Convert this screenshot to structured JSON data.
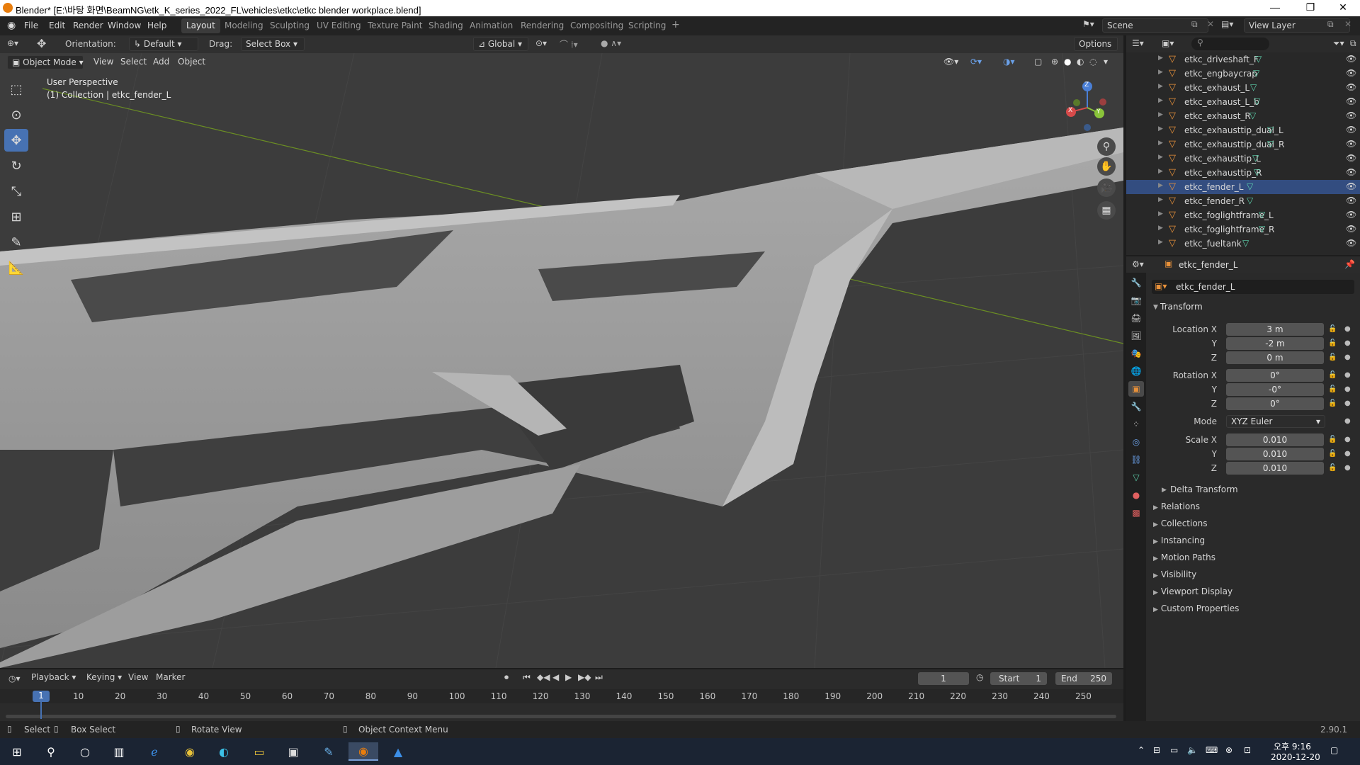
{
  "window": {
    "title": "Blender* [E:\\바탕 화면\\BeamNG\\etk_K_series_2022_FL\\vehicles\\etkc\\etkc blender workplace.blend]",
    "controls": [
      "—",
      "❐",
      "✕"
    ]
  },
  "menus": [
    "File",
    "Edit",
    "Render",
    "Window",
    "Help"
  ],
  "workspaces": [
    "Layout",
    "Modeling",
    "Sculpting",
    "UV Editing",
    "Texture Paint",
    "Shading",
    "Animation",
    "Rendering",
    "Compositing",
    "Scripting"
  ],
  "active_workspace": "Layout",
  "scene": {
    "label": "Scene",
    "view_layer": "View Layer"
  },
  "tool_header": {
    "orientation_label": "Orientation:",
    "orientation_value": "Default",
    "drag_label": "Drag:",
    "drag_value": "Select Box",
    "transform_orientation": "Global",
    "options": "Options"
  },
  "view_header": {
    "mode": "Object Mode",
    "items": [
      "View",
      "Select",
      "Add",
      "Object"
    ]
  },
  "viewport": {
    "line1": "User Perspective",
    "line2": "(1) Collection | etkc_fender_L",
    "gizmo": {
      "x": "X",
      "y": "Y",
      "z": "Z"
    }
  },
  "outliner": {
    "items": [
      "etkc_driveshaft_F",
      "etkc_engbaycrap",
      "etkc_exhaust_L",
      "etkc_exhaust_L_b",
      "etkc_exhaust_R",
      "etkc_exhausttip_dual_L",
      "etkc_exhausttip_dual_R",
      "etkc_exhausttip_L",
      "etkc_exhausttip_R",
      "etkc_fender_L",
      "etkc_fender_R",
      "etkc_foglightframe_L",
      "etkc_foglightframe_R",
      "etkc_fueltank"
    ],
    "selected": "etkc_fender_L"
  },
  "properties": {
    "header_object": "etkc_fender_L",
    "object_name": "etkc_fender_L",
    "transform_title": "Transform",
    "location": {
      "label": "Location X",
      "x": "3 m",
      "y": "-2 m",
      "z": "0 m"
    },
    "rotation": {
      "label": "Rotation X",
      "x": "0°",
      "y": "-0°",
      "z": "0°"
    },
    "mode": {
      "label": "Mode",
      "value": "XYZ Euler"
    },
    "scale": {
      "label": "Scale X",
      "x": "0.010",
      "y": "0.010",
      "z": "0.010"
    },
    "axis_y": "Y",
    "axis_z": "Z",
    "delta": "Delta Transform",
    "panels": [
      "Relations",
      "Collections",
      "Instancing",
      "Motion Paths",
      "Visibility",
      "Viewport Display",
      "Custom Properties"
    ]
  },
  "timeline": {
    "menus": [
      "Playback",
      "Keying",
      "View",
      "Marker"
    ],
    "current_frame": "1",
    "start_label": "Start",
    "start": "1",
    "end_label": "End",
    "end": "250",
    "ticks": [
      "1",
      "10",
      "20",
      "30",
      "40",
      "50",
      "60",
      "70",
      "80",
      "90",
      "100",
      "110",
      "120",
      "130",
      "140",
      "150",
      "160",
      "170",
      "180",
      "190",
      "200",
      "210",
      "220",
      "230",
      "240",
      "250"
    ]
  },
  "statusbar": {
    "select": "Select",
    "box_select": "Box Select",
    "rotate_view": "Rotate View",
    "context_menu": "Object Context Menu",
    "version": "2.90.1"
  },
  "taskbar": {
    "time": "오후 9:16",
    "date": "2020-12-20"
  },
  "colors": {
    "accent": "#4772b3",
    "object_icon": "#e8913a",
    "mesh_icon": "#5fd6b0"
  }
}
